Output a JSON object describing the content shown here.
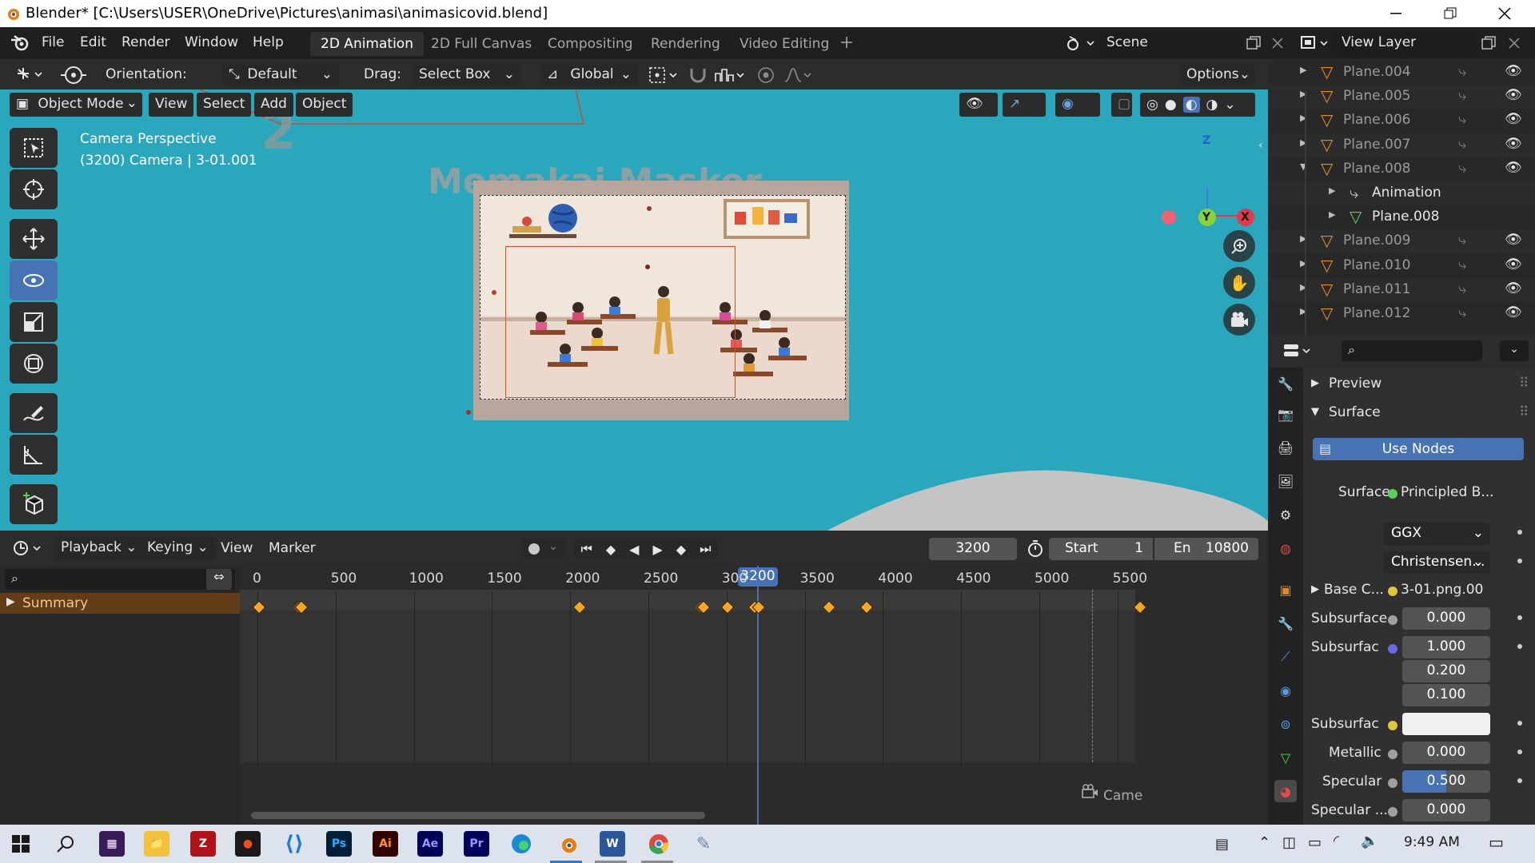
{
  "window": {
    "title": "Blender* [C:\\Users\\USER\\OneDrive\\Pictures\\animasi\\animasicovid.blend]"
  },
  "menubar": {
    "items": [
      "File",
      "Edit",
      "Render",
      "Window",
      "Help"
    ]
  },
  "workspaces": {
    "tabs": [
      "2D Animation",
      "2D Full Canvas",
      "Compositing",
      "Rendering",
      "Video Editing"
    ],
    "active": "2D Animation"
  },
  "scene": {
    "value": "Scene"
  },
  "view_layer": {
    "value": "View Layer"
  },
  "tool_header": {
    "orientation_label": "Orientation:",
    "orientation_value": "Default",
    "drag_label": "Drag:",
    "drag_value": "Select Box",
    "transform_value": "Global",
    "options_label": "Options"
  },
  "viewport_header": {
    "mode": "Object Mode",
    "view": "View",
    "select": "Select",
    "add": "Add",
    "object": "Object"
  },
  "viewport": {
    "camera_label": "Camera Perspective",
    "camera_info": "(3200) Camera | 3-01.001",
    "overlay_number": "2",
    "overlay_title": "Memakai Masker",
    "gizmo": {
      "z": "Z",
      "y": "Y",
      "x": "X"
    }
  },
  "timeline": {
    "menus": [
      "Playback",
      "Keying",
      "View",
      "Marker"
    ],
    "current_frame": "3200",
    "start_label": "Start",
    "start_value": "1",
    "end_label": "En",
    "end_value": "10800",
    "ticks": [
      "0",
      "500",
      "1000",
      "1500",
      "2000",
      "2500",
      "300",
      "3500",
      "4000",
      "4500",
      "5000",
      "5500"
    ],
    "playhead_label": "3200",
    "summary_label": "Summary",
    "keyframes": [
      10,
      255,
      263,
      271,
      282,
      2061,
      2832,
      2843,
      2854,
      3007,
      3182,
      3205,
      3653,
      3894,
      5642
    ],
    "camera_marker": "Came"
  },
  "outliner": {
    "rows": [
      {
        "name": "Plane.004",
        "type": "object"
      },
      {
        "name": "Plane.005",
        "type": "object"
      },
      {
        "name": "Plane.006",
        "type": "object"
      },
      {
        "name": "Plane.007",
        "type": "object"
      },
      {
        "name": "Plane.008",
        "type": "object",
        "expanded": true
      },
      {
        "name": "Animation",
        "type": "child"
      },
      {
        "name": "Plane.008",
        "type": "mesh"
      },
      {
        "name": "Plane.009",
        "type": "object"
      },
      {
        "name": "Plane.010",
        "type": "object"
      },
      {
        "name": "Plane.011",
        "type": "object"
      },
      {
        "name": "Plane.012",
        "type": "object"
      }
    ]
  },
  "properties": {
    "preview_label": "Preview",
    "surface_header": "Surface",
    "use_nodes": "Use Nodes",
    "surface_label": "Surface",
    "surface_value": "Principled B...",
    "distribution": "GGX",
    "subsurface_method": "Christensen...",
    "base_color_label": "Base C...",
    "base_color_value": "3-01.png.00",
    "subsurface_label": "Subsurface",
    "subsurface_value": "0.000",
    "subsurface_radius_label": "Subsurfac",
    "subsurface_radius": [
      "1.000",
      "0.200",
      "0.100"
    ],
    "subsurface_color_label": "Subsurfac",
    "metallic_label": "Metallic",
    "metallic_value": "0.000",
    "specular_label": "Specular",
    "specular_value": "0.500",
    "specular_tint_label": "Specular ...",
    "specular_tint_value": "0.000"
  },
  "taskbar": {
    "time": "9:49 AM",
    "apps": [
      "Start",
      "Search",
      "Media",
      "File Explorer",
      "Filezilla",
      "Figma",
      "VS Code",
      "Photoshop",
      "Illustrator",
      "After Effects",
      "Premiere",
      "Edge",
      "Blender",
      "Word",
      "Chrome",
      "Other"
    ]
  },
  "colors": {
    "accent": "#4772b3",
    "viewport_bg": "#2ba7bd",
    "keyframe": "#f5a623",
    "playhead": "#4772b3"
  }
}
